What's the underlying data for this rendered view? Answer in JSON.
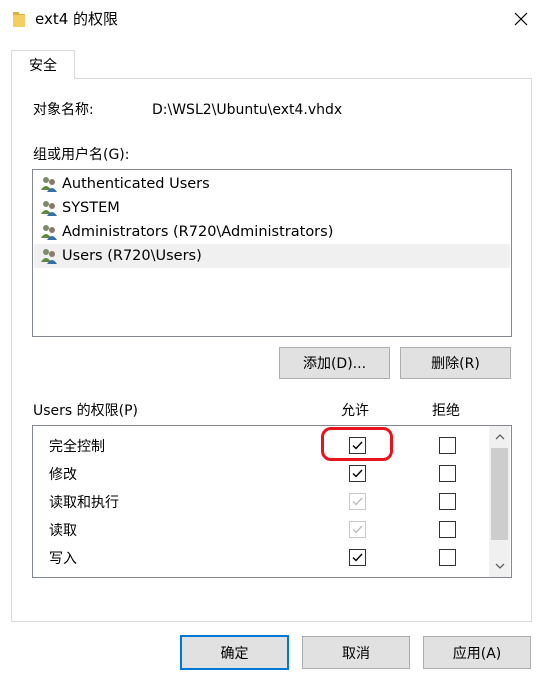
{
  "window": {
    "title": "ext4 的权限",
    "close_glyph": "✕"
  },
  "tabs": [
    {
      "label": "安全",
      "active": true
    }
  ],
  "object": {
    "label": "对象名称:",
    "value": "D:\\WSL2\\Ubuntu\\ext4.vhdx"
  },
  "groups": {
    "label": "组或用户名(G):",
    "users": [
      {
        "name": "Authenticated Users",
        "icon": "users-group-icon",
        "selected": false
      },
      {
        "name": "SYSTEM",
        "icon": "users-group-icon",
        "selected": false
      },
      {
        "name": "Administrators (R720\\Administrators)",
        "icon": "users-group-icon",
        "selected": false
      },
      {
        "name": "Users (R720\\Users)",
        "icon": "users-group-icon",
        "selected": true
      }
    ],
    "add_label": "添加(D)...",
    "remove_label": "删除(R)"
  },
  "permissions": {
    "label": "Users 的权限(P)",
    "allow_header": "允许",
    "deny_header": "拒绝",
    "rows": [
      {
        "name": "完全控制",
        "allow": true,
        "allow_disabled": false,
        "deny": false
      },
      {
        "name": "修改",
        "allow": true,
        "allow_disabled": false,
        "deny": false
      },
      {
        "name": "读取和执行",
        "allow": true,
        "allow_disabled": true,
        "deny": false
      },
      {
        "name": "读取",
        "allow": true,
        "allow_disabled": true,
        "deny": false
      },
      {
        "name": "写入",
        "allow": true,
        "allow_disabled": false,
        "deny": false
      }
    ]
  },
  "footer": {
    "ok_label": "确定",
    "cancel_label": "取消",
    "apply_label": "应用(A)"
  },
  "colors": {
    "accent": "#0078d7",
    "highlight": "#e8141c"
  }
}
